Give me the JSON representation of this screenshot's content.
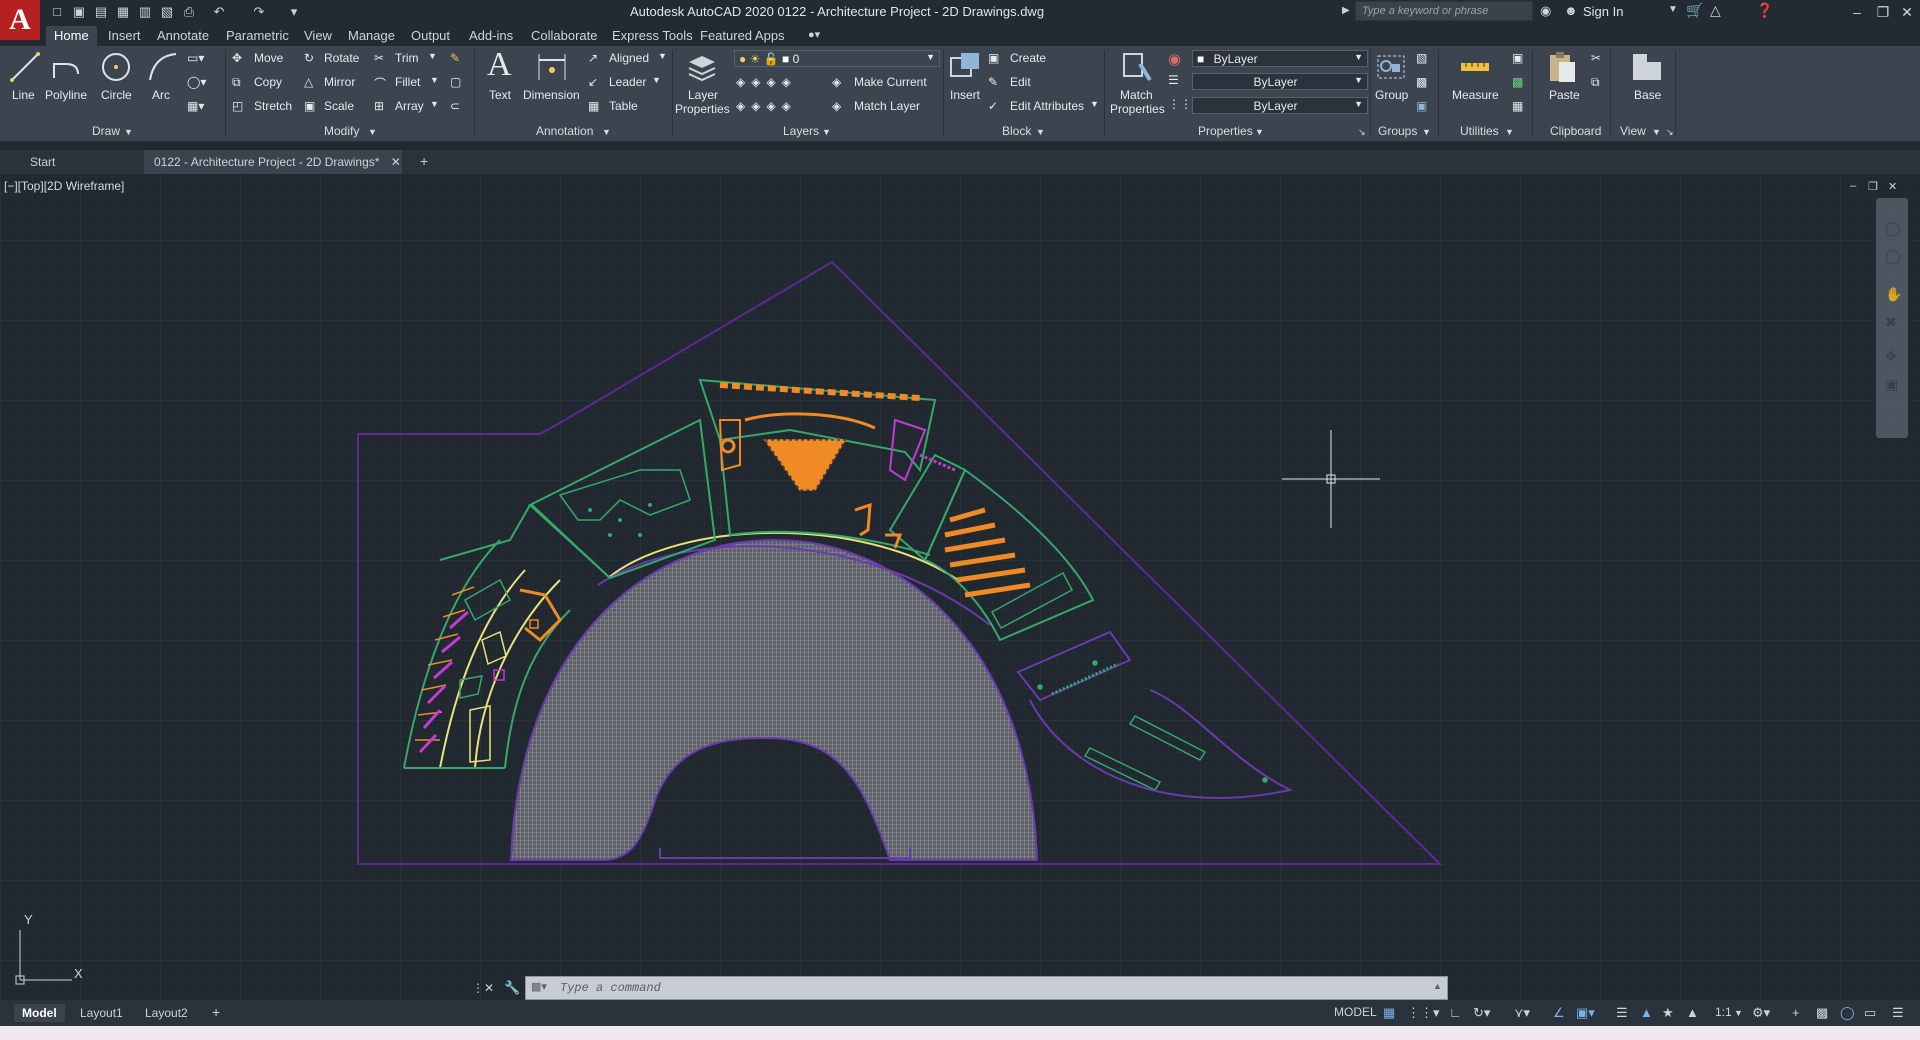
{
  "app": {
    "logo_letter": "A",
    "title": "Autodesk AutoCAD 2020    0122 - Architecture Project - 2D Drawings.dwg",
    "search_placeholder": "Type a keyword or phrase",
    "sign_in": "Sign In"
  },
  "ribbon_tabs": [
    "Home",
    "Insert",
    "Annotate",
    "Parametric",
    "View",
    "Manage",
    "Output",
    "Add-ins",
    "Collaborate",
    "Express Tools",
    "Featured Apps"
  ],
  "panels": {
    "draw": {
      "label": "Draw",
      "line": "Line",
      "polyline": "Polyline",
      "circle": "Circle",
      "arc": "Arc"
    },
    "modify": {
      "label": "Modify",
      "move": "Move",
      "rotate": "Rotate",
      "trim": "Trim",
      "copy": "Copy",
      "mirror": "Mirror",
      "fillet": "Fillet",
      "stretch": "Stretch",
      "scale": "Scale",
      "array": "Array"
    },
    "annotation": {
      "label": "Annotation",
      "text": "Text",
      "dimension": "Dimension",
      "aligned": "Aligned",
      "leader": "Leader",
      "table": "Table"
    },
    "layers": {
      "label": "Layers",
      "layer_properties_1": "Layer",
      "layer_properties_2": "Properties",
      "current_layer": "0",
      "make_current": "Make Current",
      "match_layer": "Match Layer"
    },
    "block": {
      "label": "Block",
      "insert": "Insert",
      "create": "Create",
      "edit": "Edit",
      "edit_attributes": "Edit Attributes"
    },
    "properties": {
      "label": "Properties",
      "match_1": "Match",
      "match_2": "Properties",
      "color": "ByLayer",
      "linetype": "ByLayer",
      "lineweight": "ByLayer"
    },
    "groups": {
      "label": "Groups",
      "group": "Group"
    },
    "utilities": {
      "label": "Utilities",
      "measure": "Measure"
    },
    "clipboard": {
      "label": "Clipboard",
      "paste": "Paste"
    },
    "view": {
      "label": "View",
      "base": "Base"
    }
  },
  "file_tabs": [
    "Start",
    "0122 - Architecture Project - 2D Drawings*"
  ],
  "viewport_label": "[−][Top][2D Wireframe]",
  "ucs": {
    "y": "Y",
    "x": "X"
  },
  "command_placeholder": "Type a command",
  "layout_tabs": [
    "Model",
    "Layout1",
    "Layout2"
  ],
  "status": {
    "model": "MODEL",
    "scale": "1:1"
  },
  "colors": {
    "background": "#212830",
    "ribbon": "#3c4450",
    "purple_lines": "#5b2a93",
    "green_lines": "#35a86a",
    "orange_furniture": "#f08a24",
    "magenta": "#c23bd6",
    "yellow": "#e8e27a"
  }
}
